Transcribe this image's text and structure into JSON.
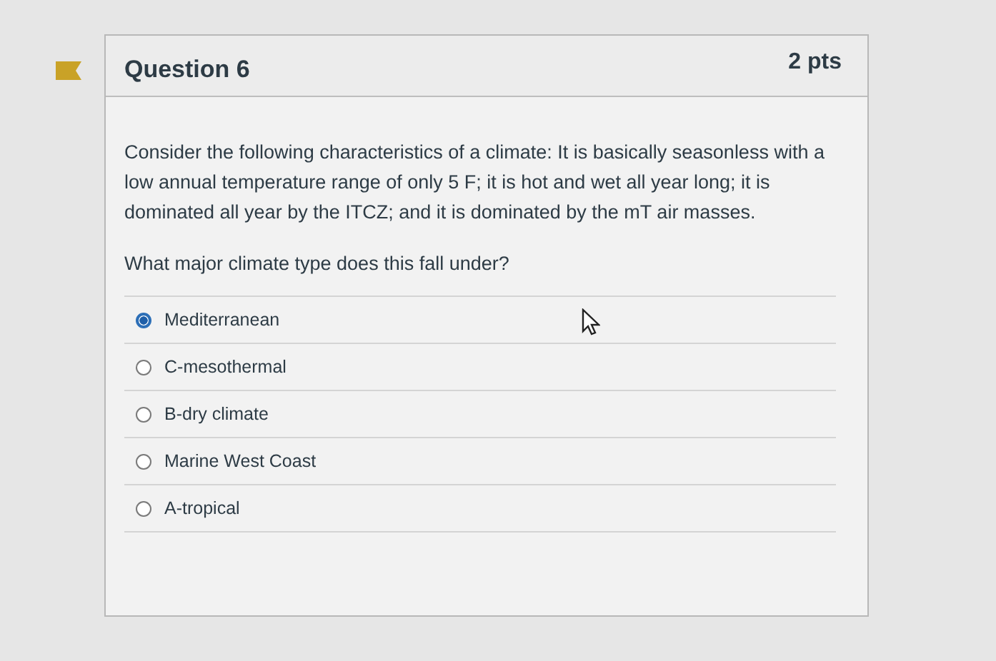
{
  "question": {
    "title": "Question 6",
    "points": "2 pts",
    "flagged": true,
    "paragraphs": [
      "Consider the following characteristics of a climate: It is basically seasonless with a low annual temperature range of only 5 F; it is hot and wet all year long; it is dominated all year by the ITCZ; and it is dominated by the mT air masses.",
      "What major climate type does this fall under?"
    ],
    "answers": [
      {
        "label": "Mediterranean",
        "selected": true
      },
      {
        "label": "C-mesothermal",
        "selected": false
      },
      {
        "label": "B-dry climate",
        "selected": false
      },
      {
        "label": "Marine West Coast",
        "selected": false
      },
      {
        "label": "A-tropical",
        "selected": false
      }
    ]
  }
}
